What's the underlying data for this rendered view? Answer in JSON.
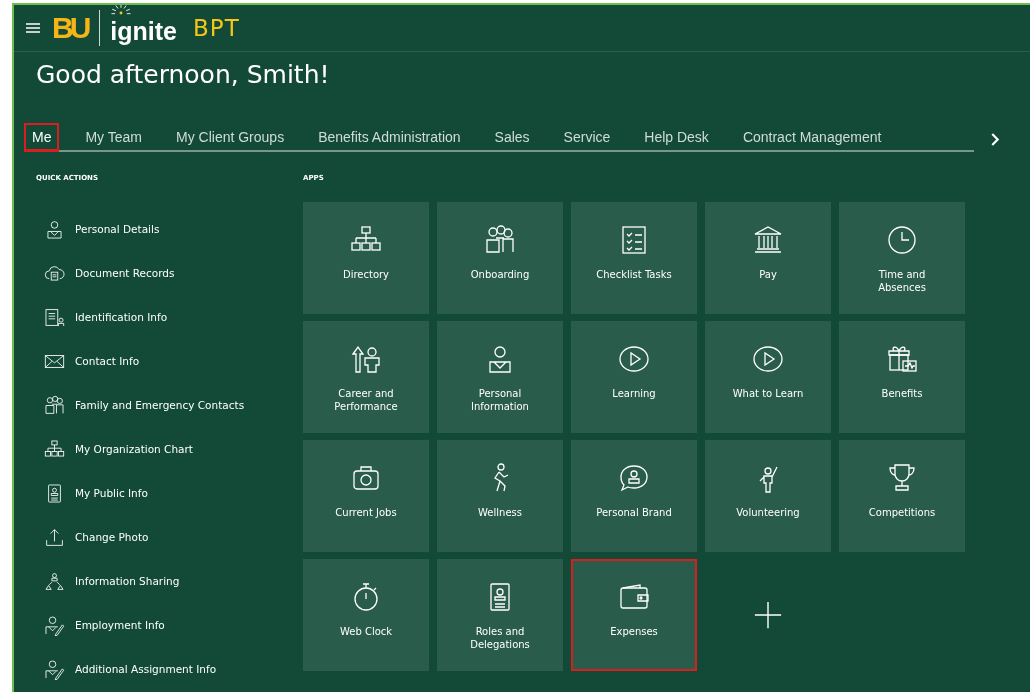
{
  "header": {
    "logo_mark": "BU",
    "app_name": "ignite",
    "app_suffix": "BPT"
  },
  "greeting": "Good afternoon, Smith!",
  "tabs": [
    {
      "label": "Me",
      "selected": true,
      "highlighted": true
    },
    {
      "label": "My Team",
      "selected": false,
      "highlighted": false
    },
    {
      "label": "My Client Groups",
      "selected": false,
      "highlighted": false
    },
    {
      "label": "Benefits Administration",
      "selected": false,
      "highlighted": false
    },
    {
      "label": "Sales",
      "selected": false,
      "highlighted": false
    },
    {
      "label": "Service",
      "selected": false,
      "highlighted": false
    },
    {
      "label": "Help Desk",
      "selected": false,
      "highlighted": false
    },
    {
      "label": "Contract Management",
      "selected": false,
      "highlighted": false
    }
  ],
  "quick_actions": {
    "title": "QUICK ACTIONS",
    "items": [
      "Personal Details",
      "Document Records",
      "Identification Info",
      "Contact Info",
      "Family and Emergency Contacts",
      "My Organization Chart",
      "My Public Info",
      "Change Photo",
      "Information Sharing",
      "Employment Info",
      "Additional Assignment Info"
    ]
  },
  "apps": {
    "title": "APPS",
    "tiles": [
      {
        "kind": "app",
        "label": "Directory",
        "highlighted": false
      },
      {
        "kind": "app",
        "label": "Onboarding",
        "highlighted": false
      },
      {
        "kind": "app",
        "label": "Checklist Tasks",
        "highlighted": false
      },
      {
        "kind": "app",
        "label": "Pay",
        "highlighted": false
      },
      {
        "kind": "app",
        "label": "Time and\nAbsences",
        "highlighted": false
      },
      {
        "kind": "app",
        "label": "Career and\nPerformance",
        "highlighted": false
      },
      {
        "kind": "app",
        "label": "Personal\nInformation",
        "highlighted": false
      },
      {
        "kind": "app",
        "label": "Learning",
        "highlighted": false
      },
      {
        "kind": "app",
        "label": "What to Learn",
        "highlighted": false
      },
      {
        "kind": "app",
        "label": "Benefits",
        "highlighted": false
      },
      {
        "kind": "app",
        "label": "Current Jobs",
        "highlighted": false
      },
      {
        "kind": "app",
        "label": "Wellness",
        "highlighted": false
      },
      {
        "kind": "app",
        "label": "Personal Brand",
        "highlighted": false
      },
      {
        "kind": "app",
        "label": "Volunteering",
        "highlighted": false
      },
      {
        "kind": "app",
        "label": "Competitions",
        "highlighted": false
      },
      {
        "kind": "app",
        "label": "Web Clock",
        "highlighted": false
      },
      {
        "kind": "app",
        "label": "Roles and\nDelegations",
        "highlighted": false
      },
      {
        "kind": "app",
        "label": "Expenses",
        "highlighted": true
      },
      {
        "kind": "add"
      }
    ]
  }
}
